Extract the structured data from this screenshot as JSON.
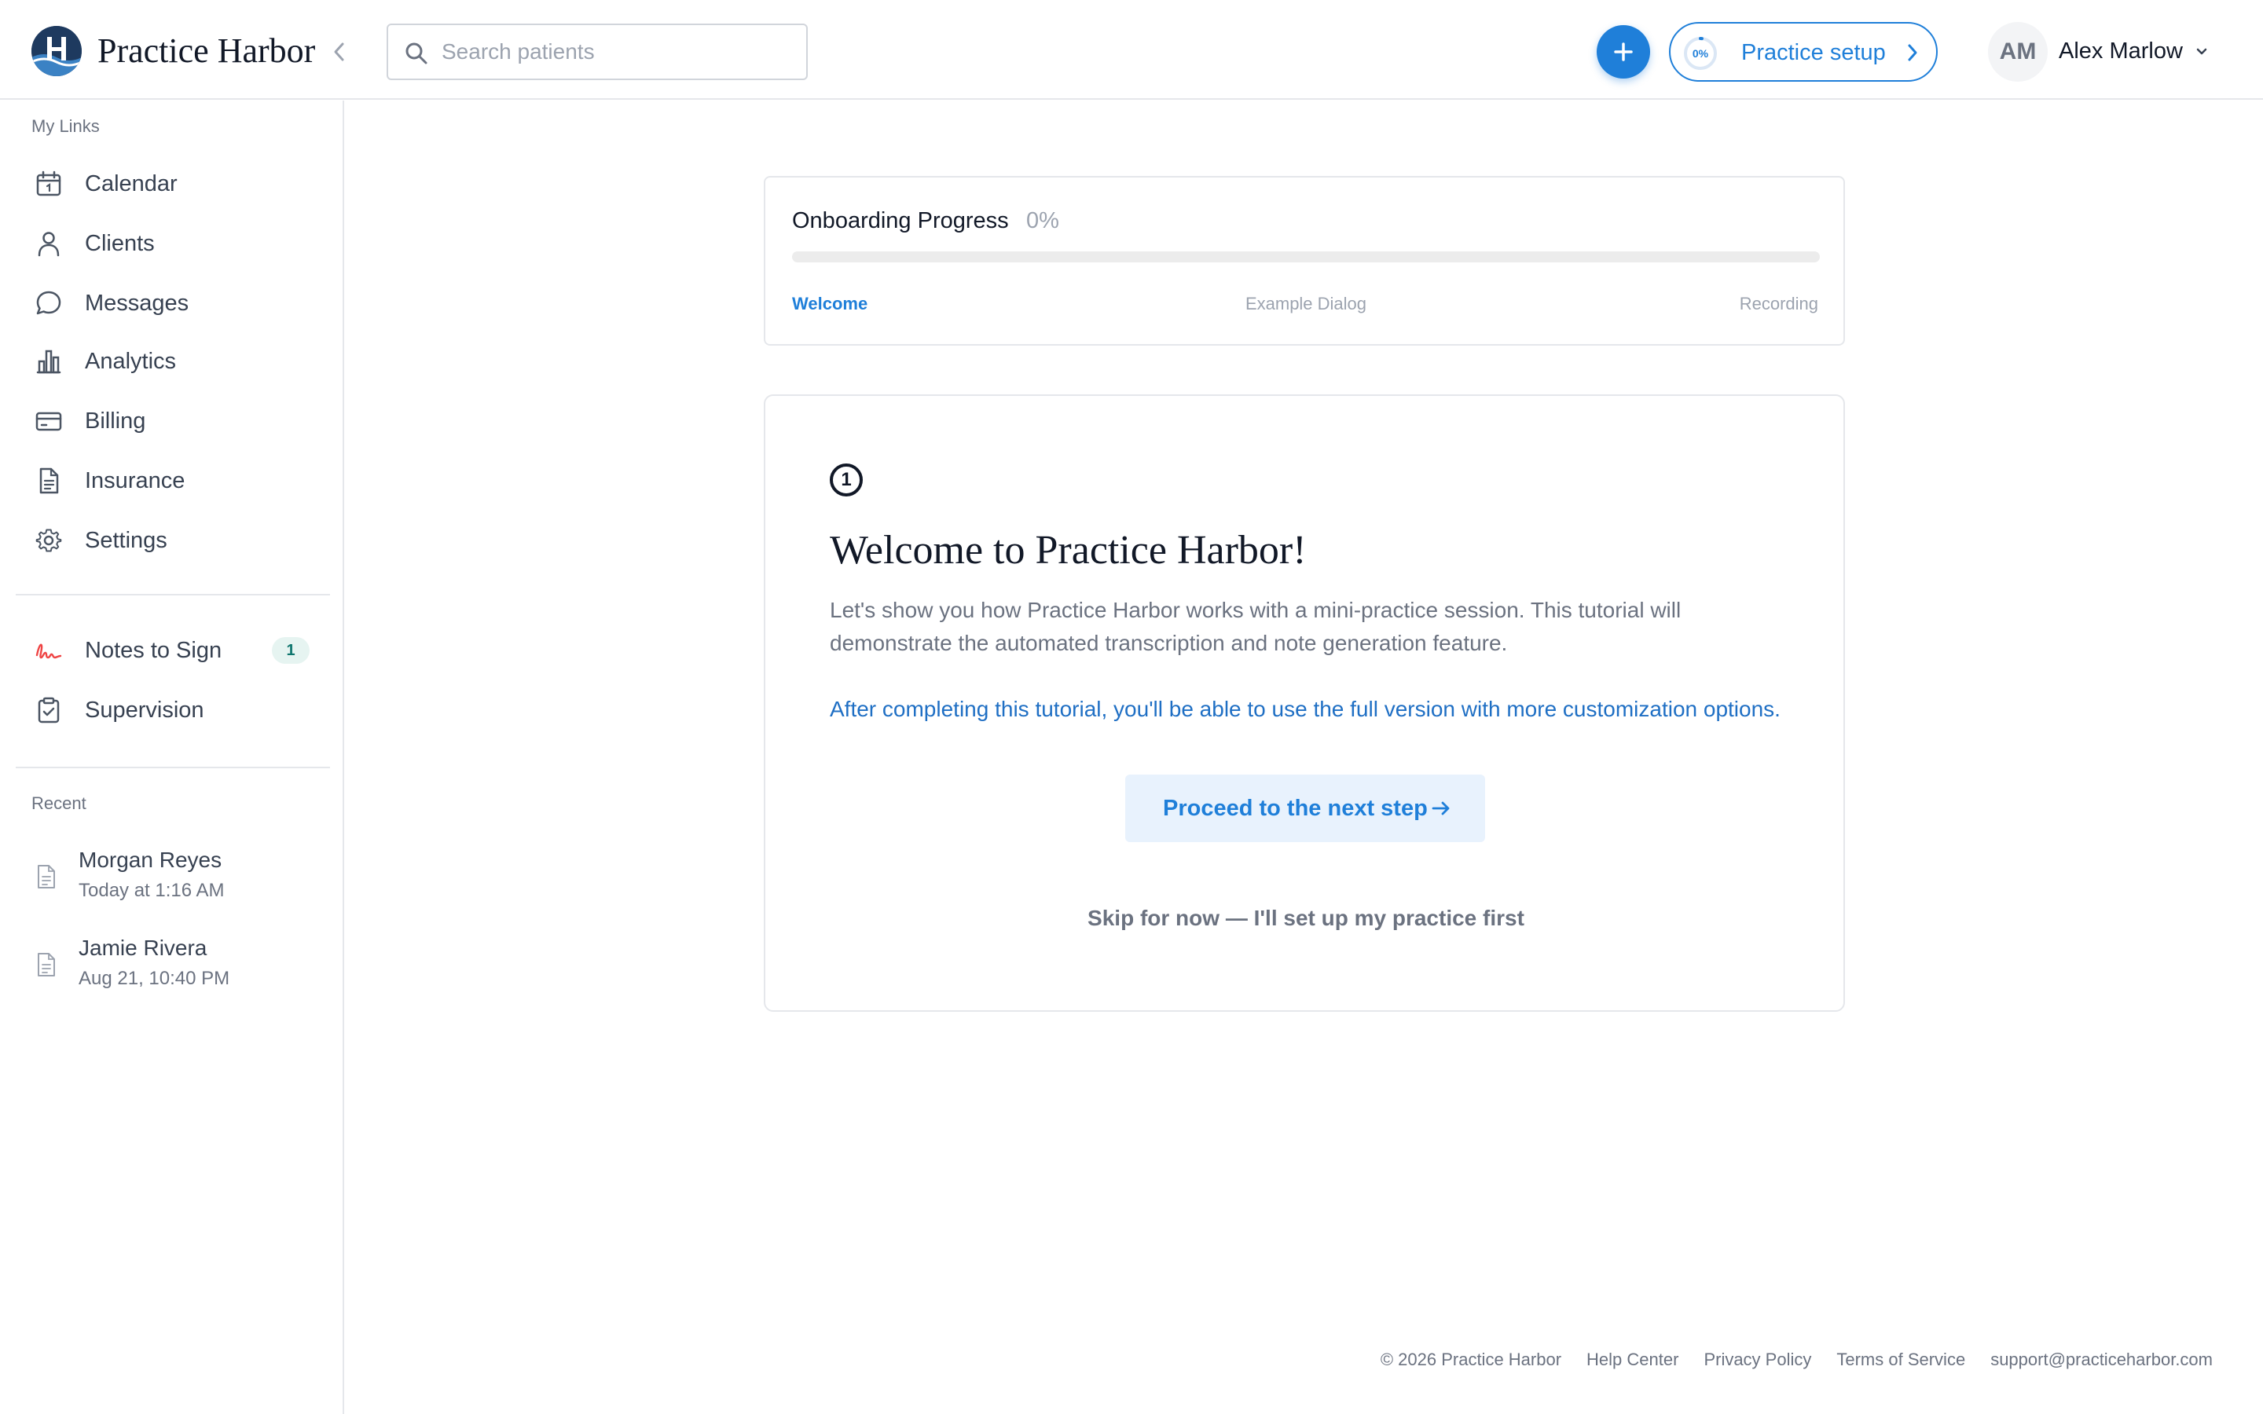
{
  "brand": {
    "name": "Practice Harbor",
    "logo_icon": "harbor-logo-icon",
    "colors": {
      "primary": "#1f7fd9",
      "navy": "#1e3a5f",
      "muted": "#6b7280",
      "signature": "#ef4444"
    }
  },
  "header": {
    "search_placeholder": "Search patients",
    "add_icon": "plus-icon",
    "setup": {
      "progress_text": "0%",
      "progress": 0,
      "label": "Practice setup"
    },
    "user": {
      "initials": "AM",
      "name": "Alex Marlow"
    }
  },
  "sidebar": {
    "my_links_title": "My Links",
    "links": [
      {
        "label": "Calendar",
        "icon": "calendar-icon"
      },
      {
        "label": "Clients",
        "icon": "user-icon"
      },
      {
        "label": "Messages",
        "icon": "chat-bubble-icon"
      },
      {
        "label": "Analytics",
        "icon": "bar-chart-icon"
      },
      {
        "label": "Billing",
        "icon": "credit-card-icon"
      },
      {
        "label": "Insurance",
        "icon": "document-icon"
      },
      {
        "label": "Settings",
        "icon": "gear-icon"
      }
    ],
    "tasks": [
      {
        "label": "Notes to Sign",
        "icon": "signature-icon",
        "badge": "1"
      },
      {
        "label": "Supervision",
        "icon": "clipboard-check-icon"
      }
    ],
    "recent_title": "Recent",
    "recent": [
      {
        "name": "Morgan Reyes",
        "time": "Today at 1:16 AM"
      },
      {
        "name": "Jamie Rivera",
        "time": "Aug 21, 10:40 PM"
      }
    ]
  },
  "onboarding": {
    "title": "Onboarding Progress",
    "percent_text": "0%",
    "progress": 0,
    "steps": [
      "Welcome",
      "Example Dialog",
      "Recording"
    ],
    "active_step": 0
  },
  "welcome": {
    "step_number": "1",
    "title": "Welcome to Practice Harbor!",
    "description": "Let's show you how Practice Harbor works with a mini-practice session. This tutorial will demonstrate the automated transcription and note generation feature.",
    "note": "After completing this tutorial, you'll be able to use the full version with more customization options.",
    "next_button": "Proceed to the next step",
    "skip_link": "Skip for now — I'll set up my practice first"
  },
  "footer": {
    "copyright": "© 2026 Practice Harbor",
    "links": [
      "Help Center",
      "Privacy Policy",
      "Terms of Service"
    ],
    "email": "support@practiceharbor.com"
  }
}
